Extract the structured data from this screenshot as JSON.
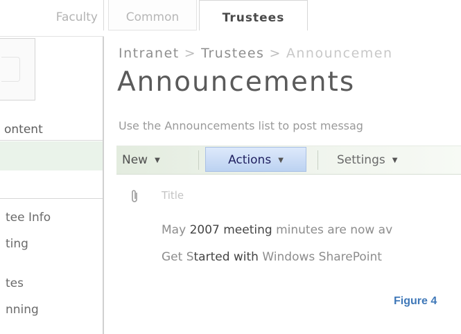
{
  "tabs": [
    {
      "label": "Faculty"
    },
    {
      "label": "Common"
    },
    {
      "label": "Trustees",
      "selected": true
    }
  ],
  "left_nav": {
    "content_header": "ontent",
    "items": [
      "tee Info",
      "ting",
      "tes",
      "nning"
    ]
  },
  "breadcrumb": {
    "items": [
      "Intranet",
      "Trustees",
      "Announcemen"
    ],
    "separator": ">"
  },
  "page_title": "Announcements",
  "description": "Use the Announcements list to post messag",
  "toolbar": {
    "new_label": "New",
    "actions_label": "Actions",
    "settings_label": "Settings"
  },
  "list": {
    "attachment_icon": "paperclip-icon",
    "title_column": "Title",
    "items": [
      {
        "pre": "May ",
        "bold": "2007 meeting",
        "post": " minutes are now av"
      },
      {
        "pre": "Get S",
        "bold": "tarted with",
        "post": " Windows SharePoint"
      }
    ]
  },
  "figure_label": "Figure 4",
  "colors": {
    "toolbar_bg": "#e3ecdf",
    "actions_highlight": "#bcd2f1",
    "figure_label": "#3f78b8"
  }
}
